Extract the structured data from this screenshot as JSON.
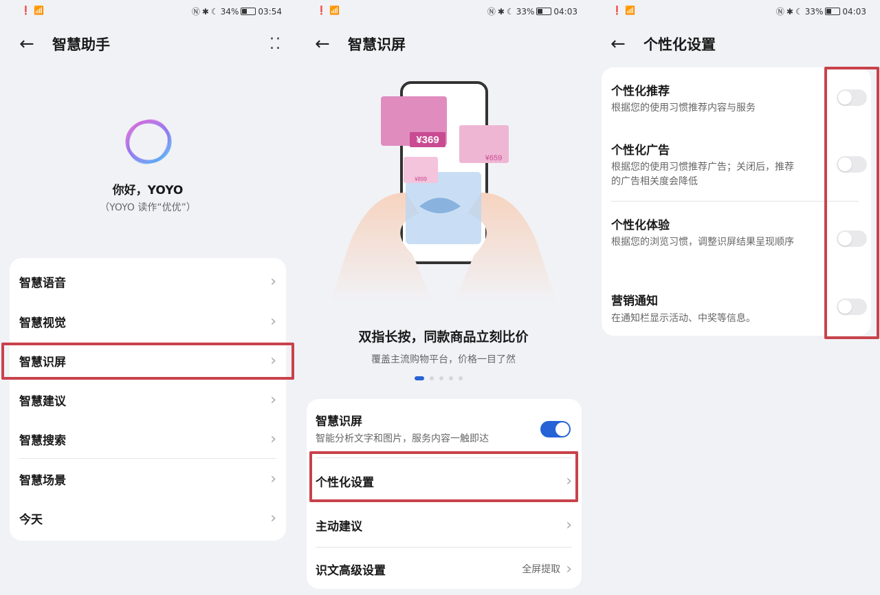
{
  "panel1": {
    "status": {
      "time": "03:54",
      "battery": "34%"
    },
    "title": "智慧助手",
    "greeting": "你好，YOYO",
    "sub": "（YOYO 读作“优优”）",
    "items": [
      {
        "label": "智慧语音"
      },
      {
        "label": "智慧视觉"
      },
      {
        "label": "智慧识屏"
      },
      {
        "label": "智慧建议"
      },
      {
        "label": "智慧搜索"
      },
      {
        "label": "智慧场景"
      },
      {
        "label": "今天"
      }
    ]
  },
  "panel2": {
    "status": {
      "time": "04:03",
      "battery": "33%"
    },
    "title": "智慧识屏",
    "price1": "¥369",
    "price2": "¥659",
    "price3": "¥899",
    "headline": "双指长按，同款商品立刻比价",
    "subline": "覆盖主流购物平台，价格一目了然",
    "feature_title": "智慧识屏",
    "feature_desc": "智能分析文字和图片，服务内容一触即达",
    "items": [
      {
        "label": "个性化设置",
        "value": ""
      },
      {
        "label": "主动建议",
        "value": ""
      },
      {
        "label": "识文高级设置",
        "value": "全屏提取"
      }
    ]
  },
  "panel3": {
    "status": {
      "time": "04:03",
      "battery": "33%"
    },
    "title": "个性化设置",
    "items": [
      {
        "title": "个性化推荐",
        "desc": "根据您的使用习惯推荐内容与服务"
      },
      {
        "title": "个性化广告",
        "desc": "根据您的使用习惯推荐广告；关闭后，推荐的广告相关度会降低"
      },
      {
        "title": "个性化体验",
        "desc": "根据您的浏览习惯，调整识屏结果呈现顺序"
      },
      {
        "title": "营销通知",
        "desc": "在通知栏显示活动、中奖等信息。"
      }
    ]
  },
  "colors": {
    "accent": "#2563d6",
    "highlight": "#c8424b"
  }
}
